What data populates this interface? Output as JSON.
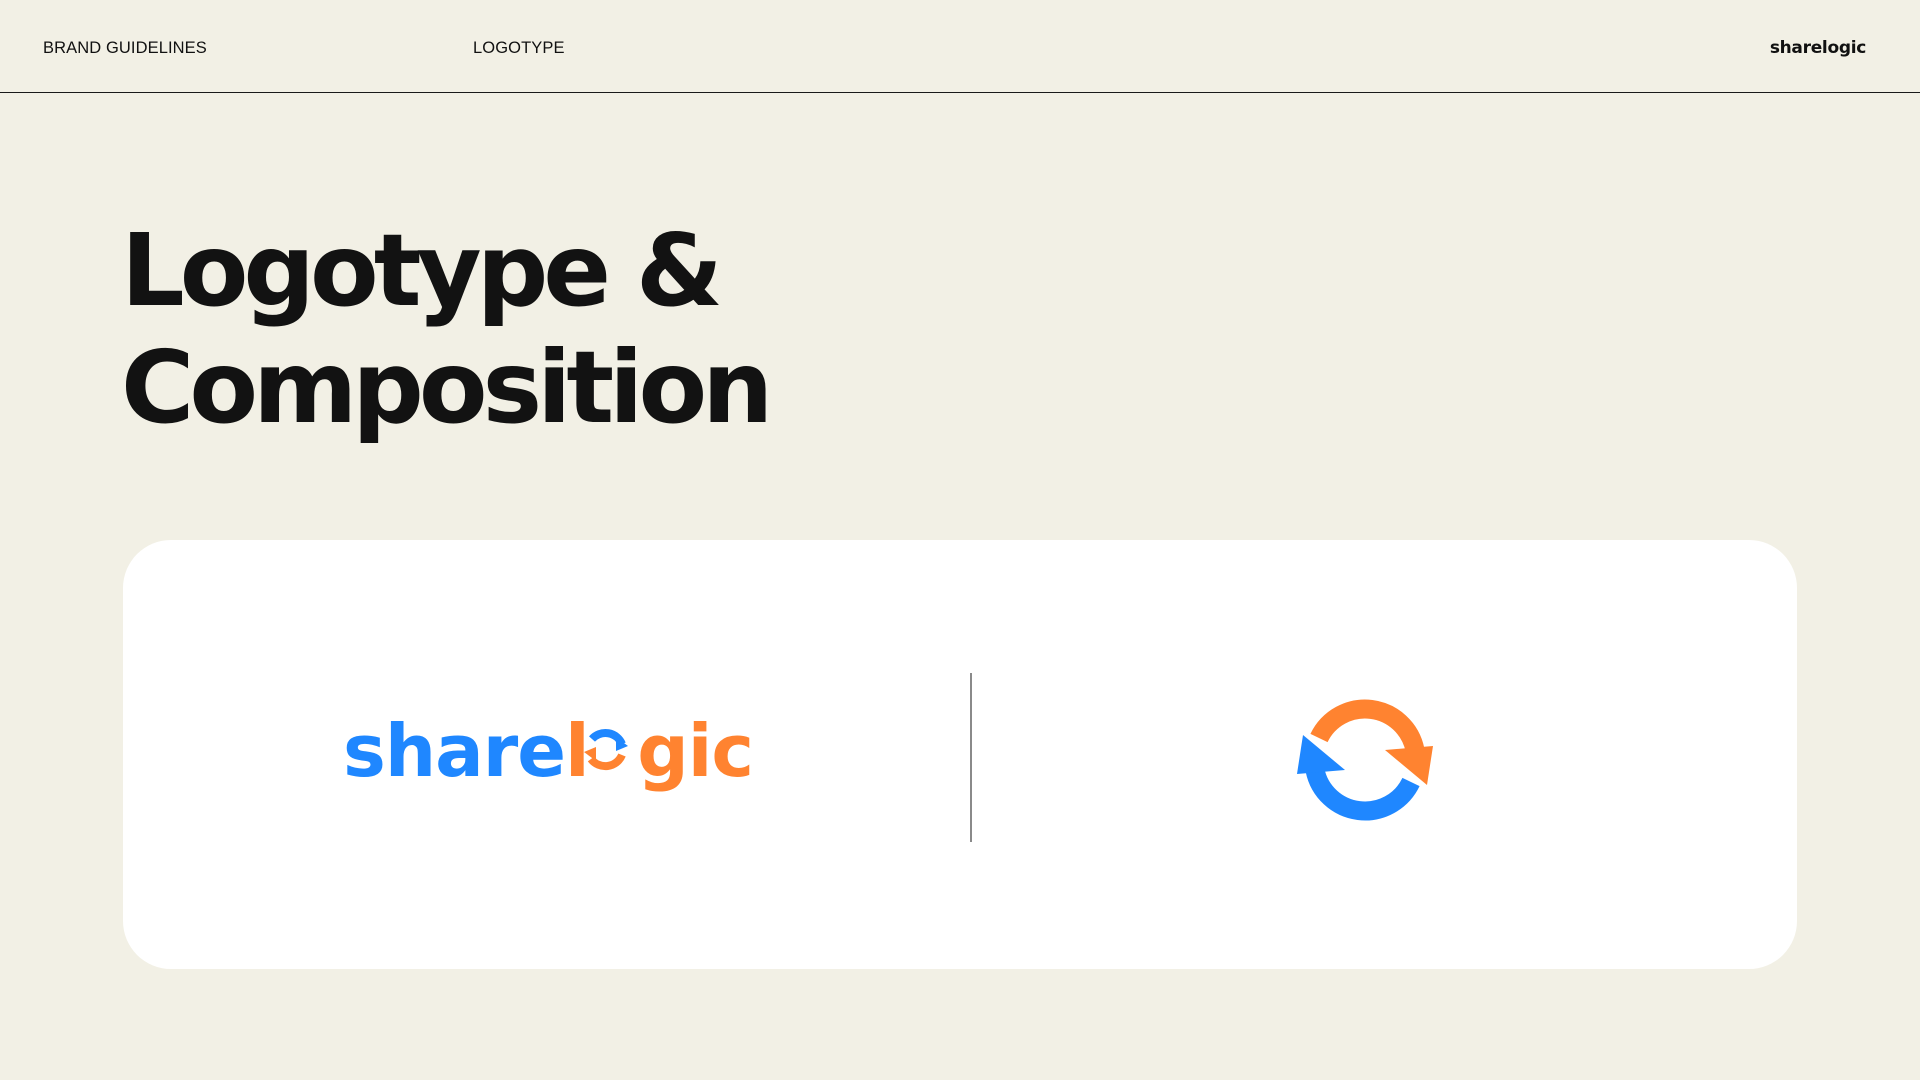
{
  "header": {
    "section_left": "BRAND GUIDELINES",
    "section_mid": "LOGOTYPE",
    "brand": "sharelogic"
  },
  "title": {
    "line1": "Logotype &",
    "line2": "Composition"
  },
  "logo": {
    "wordmark_blue_part": "share",
    "wordmark_orange_part": "l",
    "wordmark_orange_tail": "gic",
    "colors": {
      "blue": "#1f87ff",
      "orange": "#ff8330"
    },
    "symbol_icon": "sync-arrows-icon"
  },
  "colors": {
    "background": "#f2f0e5",
    "card": "#ffffff",
    "text": "#111111"
  }
}
